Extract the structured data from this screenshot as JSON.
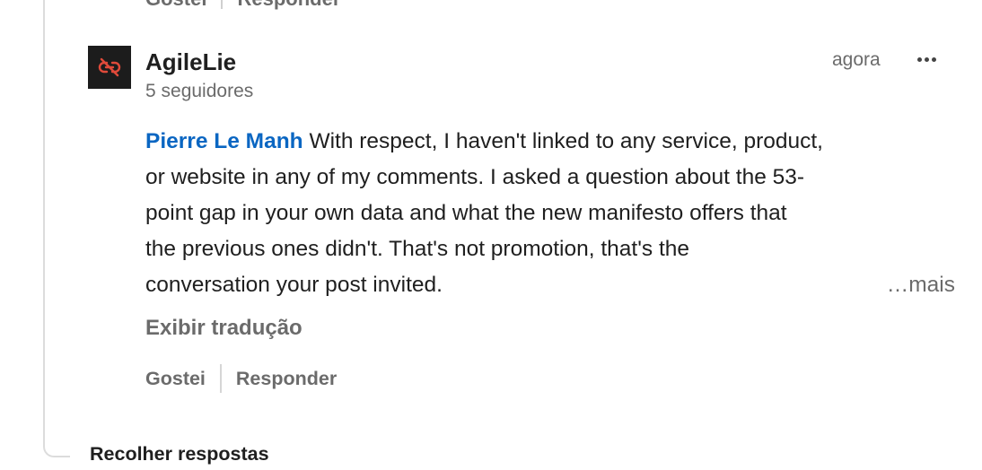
{
  "previous_comment": {
    "like_label": "Gostei",
    "reply_label": "Responder"
  },
  "comment": {
    "author": {
      "name": "AgileLie",
      "followers": "5 seguidores",
      "avatar_icon": "broken-link-icon",
      "avatar_bg": "#1c1c1c",
      "avatar_icon_color": "#e04a3a"
    },
    "timestamp": "agora",
    "more_icon": "ellipsis-icon",
    "mention": "Pierre Le Manh",
    "text_lines": [
      " With respect, I haven't linked to any service, product,",
      "or website in any of my comments. I asked a question about the 53-",
      "point gap in your own data and what the new manifesto offers that",
      "the previous ones didn't. That's not promotion, that's the",
      "conversation your post invited."
    ],
    "see_more": "…mais",
    "translate_label": "Exibir tradução",
    "like_label": "Gostei",
    "reply_label": "Responder"
  },
  "thread": {
    "collapse_label": "Recolher respostas"
  },
  "colors": {
    "mention": "#0a66c2",
    "muted": "#6b6b6b",
    "text": "#1f1f1f"
  }
}
